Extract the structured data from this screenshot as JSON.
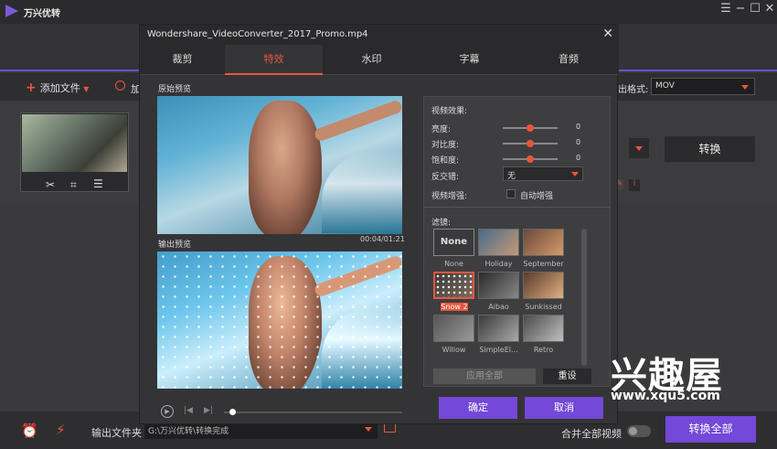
{
  "app": {
    "name": "万兴优转"
  },
  "toolbar": {
    "add_file": "添加文件",
    "add_more": "加",
    "output_format_label": "出格式:",
    "output_format_value": "MOV"
  },
  "main": {
    "convert": "转换"
  },
  "bottom": {
    "output_folder_label": "输出文件夹",
    "output_path": "G:\\万兴优转\\转换完成",
    "merge_label": "合并全部视频",
    "convert_all": "转换全部"
  },
  "dialog": {
    "title": "Wondershare_VideoConverter_2017_Promo.mp4",
    "tabs": [
      "裁剪",
      "特效",
      "水印",
      "字幕",
      "音频"
    ],
    "active_tab": "特效",
    "original_preview": "原始预览",
    "output_preview": "输出预览",
    "timecode": "00:04/01:21",
    "panel": {
      "video_effects": "视频效果:",
      "brightness": {
        "label": "亮度:",
        "value": "0"
      },
      "contrast": {
        "label": "对比度:",
        "value": "0"
      },
      "saturation": {
        "label": "饱和度:",
        "value": "0"
      },
      "deinterlace": {
        "label": "反交错:",
        "value": "无"
      },
      "enhance": {
        "label": "视频增强:",
        "option": "自动增强"
      },
      "filters_label": "滤镜:",
      "filters": [
        "None",
        "Holiday",
        "September",
        "Snow 2",
        "Aibao",
        "Sunkissed",
        "Willow",
        "SimpleEl...",
        "Retro"
      ],
      "selected_filter": "Snow 2",
      "apply_all": "应用全部",
      "reset": "重设"
    },
    "ok": "确定",
    "cancel": "取消"
  },
  "watermark": {
    "text": "兴趣屋",
    "url": "www.xqu5.com"
  },
  "colors": {
    "accent": "#e8563c",
    "purple": "#7448d8"
  }
}
